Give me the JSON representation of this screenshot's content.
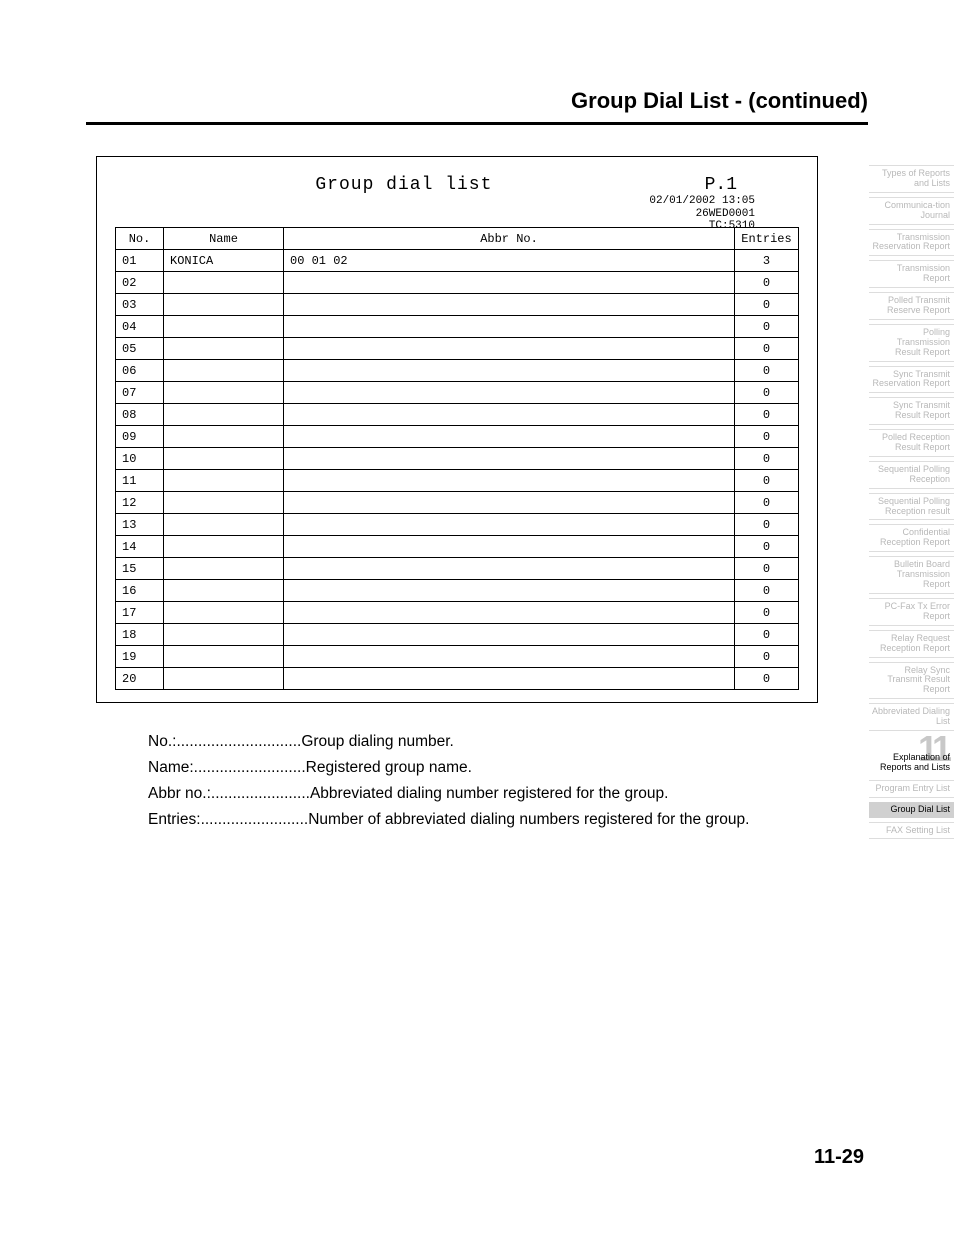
{
  "page_title": "Group Dial List -  (continued)",
  "report": {
    "title": "Group dial list",
    "page_label": "P.1",
    "meta": "02/01/2002 13:05\n26WED0001\nTC:5310",
    "headers": {
      "no": "No.",
      "name": "Name",
      "abbr": "Abbr No.",
      "entries": "Entries"
    },
    "rows": [
      {
        "no": "01",
        "name": "KONICA",
        "abbr": "00  01  02",
        "entries": "3"
      },
      {
        "no": "02",
        "name": "",
        "abbr": "",
        "entries": "0"
      },
      {
        "no": "03",
        "name": "",
        "abbr": "",
        "entries": "0"
      },
      {
        "no": "04",
        "name": "",
        "abbr": "",
        "entries": "0"
      },
      {
        "no": "05",
        "name": "",
        "abbr": "",
        "entries": "0"
      },
      {
        "no": "06",
        "name": "",
        "abbr": "",
        "entries": "0"
      },
      {
        "no": "07",
        "name": "",
        "abbr": "",
        "entries": "0"
      },
      {
        "no": "08",
        "name": "",
        "abbr": "",
        "entries": "0"
      },
      {
        "no": "09",
        "name": "",
        "abbr": "",
        "entries": "0"
      },
      {
        "no": "10",
        "name": "",
        "abbr": "",
        "entries": "0"
      },
      {
        "no": "11",
        "name": "",
        "abbr": "",
        "entries": "0"
      },
      {
        "no": "12",
        "name": "",
        "abbr": "",
        "entries": "0"
      },
      {
        "no": "13",
        "name": "",
        "abbr": "",
        "entries": "0"
      },
      {
        "no": "14",
        "name": "",
        "abbr": "",
        "entries": "0"
      },
      {
        "no": "15",
        "name": "",
        "abbr": "",
        "entries": "0"
      },
      {
        "no": "16",
        "name": "",
        "abbr": "",
        "entries": "0"
      },
      {
        "no": "17",
        "name": "",
        "abbr": "",
        "entries": "0"
      },
      {
        "no": "18",
        "name": "",
        "abbr": "",
        "entries": "0"
      },
      {
        "no": "19",
        "name": "",
        "abbr": "",
        "entries": "0"
      },
      {
        "no": "20",
        "name": "",
        "abbr": "",
        "entries": "0"
      }
    ]
  },
  "definitions": [
    {
      "label": "No.: ",
      "dots": ".............................",
      "value": "Group dialing number."
    },
    {
      "label": "Name: ",
      "dots": "..........................",
      "value": "Registered group name."
    },
    {
      "label": "Abbr no.: ",
      "dots": ".......................",
      "value": "Abbreviated dialing number registered for the group."
    },
    {
      "label": "Entries:",
      "dots": ".........................",
      "value": "Number of abbreviated dialing numbers registered for the group."
    }
  ],
  "sidebar": {
    "tabs": [
      "Types of Reports and Lists",
      "Communica-tion Journal",
      "Transmission Reservation Report",
      "Transmission Report",
      "Polled Transmit Reserve Report",
      "Polling Transmission Result Report",
      "Sync Transmit Reservation Report",
      "Sync Transmit Result Report",
      "Polled Reception Result Report",
      "Sequential Polling Reception",
      "Sequential Polling Reception result",
      "Confidential Reception Report",
      "Bulletin Board Transmission Report",
      "PC-Fax Tx Error Report",
      "Relay Request Reception Report",
      "Relay Sync Transmit Result Report",
      "Abbreviated Dialing List"
    ],
    "section_num": "11",
    "section_label": "Explanation of Reports and Lists",
    "tabs2": [
      "Program Entry List"
    ],
    "active": "Group Dial List",
    "tabs3": [
      "FAX Setting List"
    ]
  },
  "page_number": "11-29"
}
